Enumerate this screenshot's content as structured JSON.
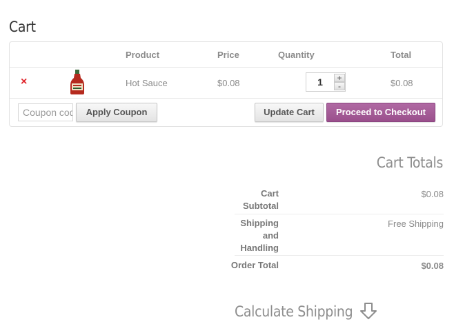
{
  "page": {
    "title": "Cart"
  },
  "cart": {
    "headers": {
      "product": "Product",
      "price": "Price",
      "quantity": "Quantity",
      "total": "Total"
    },
    "items": [
      {
        "remove": "×",
        "name": "Hot Sauce",
        "price": "$0.08",
        "quantity": "1",
        "total": "$0.08"
      }
    ],
    "qty_plus": "+",
    "qty_minus": "-"
  },
  "actions": {
    "coupon_placeholder": "Coupon code",
    "apply_coupon": "Apply Coupon",
    "update_cart": "Update Cart",
    "checkout": "Proceed to Checkout"
  },
  "totals": {
    "title": "Cart Totals",
    "subtotal_label": "Cart Subtotal",
    "subtotal_value": "$0.08",
    "shipping_label": "Shipping and Handling",
    "shipping_value": "Free Shipping",
    "order_total_label": "Order Total",
    "order_total_value": "$0.08"
  },
  "shipping": {
    "calc_label": "Calculate Shipping",
    "icon": "arrow-down-outline-icon"
  },
  "colors": {
    "checkout": "#9b5190",
    "remove": "#e0242b"
  }
}
